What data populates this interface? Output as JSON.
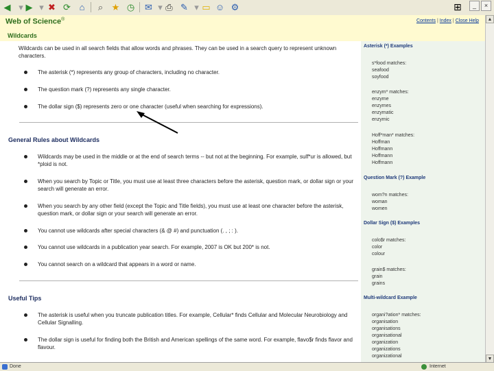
{
  "browser": {
    "status_left": "Done",
    "status_right": "Internet"
  },
  "header": {
    "brand": "Web of Science",
    "brand_mark": "®",
    "links": [
      "Contents",
      "Index",
      "Close Help"
    ],
    "separator": "|",
    "page_title": "Wildcards"
  },
  "main": {
    "intro": "Wildcards can be used in all search fields that allow words and phrases. They can be used in a search query to represent unknown characters.",
    "bullets1": [
      "The asterisk (*) represents any group of characters, including no character.",
      "The question mark (?) represents any single character.",
      "The dollar sign ($) represents zero or one character (useful when searching for expressions)."
    ],
    "section2_title": "General Rules about Wildcards",
    "bullets2": [
      "Wildcards may be used in the middle or at the end of search terms -- but not at the beginning. For example, sulf*ur is allowed, but *ploid is not.",
      "When you search by Topic or Title, you must use at least three characters before the asterisk, question mark, or dollar sign or your search will generate an error.",
      "When you search by any other field (except the Topic and Title fields), you must use at least one character before the asterisk, question mark, or dollar sign or your search will generate an error.",
      "You cannot use wildcards after special characters (& @ #) and punctuation (. , ; : ).",
      "You cannot use wildcards in a publication year search. For example, 2007 is OK but 200* is not.",
      "You cannot search on a wildcard that appears in a word or name."
    ],
    "section3_title": "Useful Tips",
    "bullets3": [
      "The asterisk is useful when you truncate publication titles. For example, Cellular* finds Cellular and Molecular Neurobiology and Cellular Signalling.",
      "The dollar sign is useful for finding both the British and American spellings of the same word. For example, flavo$r finds flavor and flavour."
    ]
  },
  "sidebar": {
    "asterisk_title": "Asterisk (*) Examples",
    "group1_head": "s*food matches:",
    "group1_items": [
      "seafood",
      "soyfood"
    ],
    "group2_head": "enzym* matches:",
    "group2_items": [
      "enzyme",
      "enzymes",
      "enzymatic",
      "enzymic"
    ],
    "group3_head": "Hoff*man* matches:",
    "group3_items": [
      "Hoffman",
      "Hoffmann",
      "Hoffmann",
      "Hoffmann"
    ],
    "qmark_title": "Question Mark (?) Example",
    "group4_head": "wom?n matches:",
    "group4_items": [
      "woman",
      "women"
    ],
    "dollar_title": "Dollar Sign ($) Examples",
    "group5_head": "colo$r matches:",
    "group5_items": [
      "color",
      "colour"
    ],
    "group6_head": "grain$ matches:",
    "group6_items": [
      "grain",
      "grains"
    ],
    "multi_title": "Multi-wildcard Example",
    "group7_head": "organi?ation* matches:",
    "group7_items": [
      "organisation",
      "organisations",
      "organisational",
      "organization",
      "organizations",
      "organizational"
    ]
  }
}
